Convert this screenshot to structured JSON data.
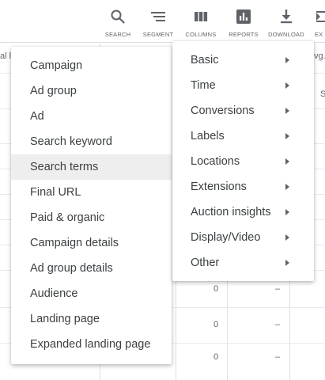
{
  "toolbar": {
    "search": "SEARCH",
    "segment": "SEGMENT",
    "columns": "COLUMNS",
    "reports": "REPORTS",
    "download": "DOWNLOAD",
    "expand": "EX"
  },
  "table": {
    "header_left": "al l",
    "header_right": "vg.",
    "side_letter": "S",
    "rows": [
      {
        "value": "0",
        "dash": "–"
      },
      {
        "value": "0",
        "dash": "–"
      },
      {
        "value": "0",
        "dash": "–"
      }
    ]
  },
  "menu_left": {
    "items": [
      {
        "label": "Campaign"
      },
      {
        "label": "Ad group"
      },
      {
        "label": "Ad"
      },
      {
        "label": "Search keyword"
      },
      {
        "label": "Search terms"
      },
      {
        "label": "Final URL"
      },
      {
        "label": "Paid & organic"
      },
      {
        "label": "Campaign details"
      },
      {
        "label": "Ad group details"
      },
      {
        "label": "Audience"
      },
      {
        "label": "Landing page"
      },
      {
        "label": "Expanded landing page"
      }
    ],
    "highlighted": "Search terms"
  },
  "menu_right": {
    "items": [
      {
        "label": "Basic"
      },
      {
        "label": "Time"
      },
      {
        "label": "Conversions"
      },
      {
        "label": "Labels"
      },
      {
        "label": "Locations"
      },
      {
        "label": "Extensions"
      },
      {
        "label": "Auction insights"
      },
      {
        "label": "Display/Video"
      },
      {
        "label": "Other"
      }
    ]
  },
  "colors": {
    "text": "#3c4043",
    "icon": "#5f6368",
    "highlight": "#eeeeee",
    "divider": "#dadce0"
  }
}
